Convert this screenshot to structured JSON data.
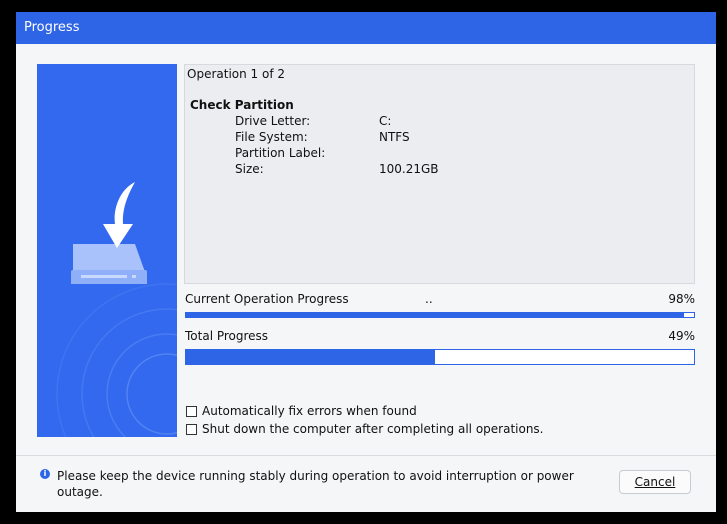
{
  "window": {
    "title": "Progress"
  },
  "details": {
    "operation_header": "Operation 1 of 2",
    "section_title": "Check Partition",
    "fields": [
      {
        "label": "Drive Letter:",
        "value": "C:"
      },
      {
        "label": "File System:",
        "value": "NTFS"
      },
      {
        "label": "Partition Label:",
        "value": ""
      },
      {
        "label": "Size:",
        "value": "100.21GB"
      }
    ]
  },
  "progress": {
    "current_label": "Current Operation Progress",
    "current_status": "..",
    "current_percent_text": "98%",
    "current_percent": 98,
    "total_label": "Total Progress",
    "total_percent_text": "49%",
    "total_percent": 49
  },
  "options": {
    "auto_fix_label": "Automatically fix errors when found",
    "auto_fix_checked": false,
    "shutdown_label": "Shut down the computer after completing all operations.",
    "shutdown_checked": false
  },
  "footer": {
    "notice": "Please keep the device running stably during operation to avoid interruption or power outage.",
    "cancel_label": "Cancel"
  },
  "colors": {
    "accent": "#2e64e6",
    "sidebar": "#3269ee"
  },
  "icons": {
    "sidebar_illustration": "disk-download-icon",
    "info": "info-icon"
  }
}
